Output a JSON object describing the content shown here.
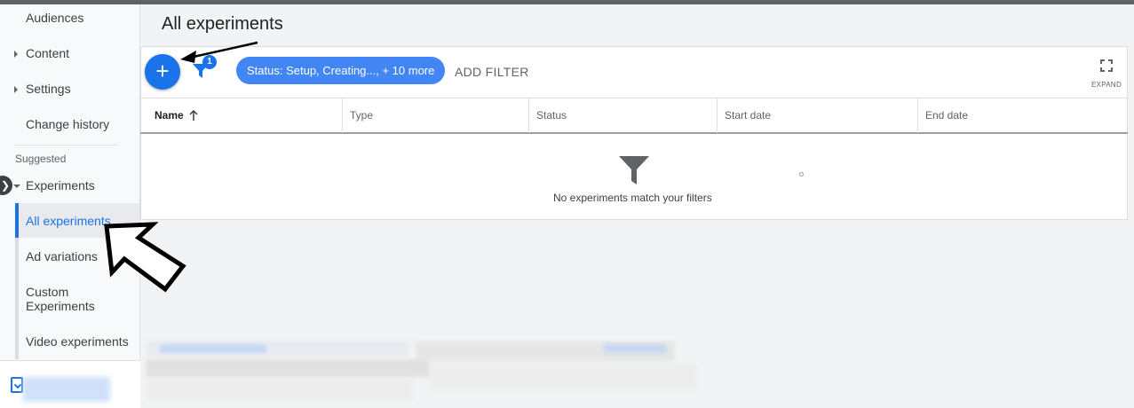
{
  "page": {
    "title": "All experiments"
  },
  "sidebar": {
    "items": [
      {
        "label": "Audiences",
        "caret": false
      },
      {
        "label": "Content",
        "caret": true
      },
      {
        "label": "Settings",
        "caret": true
      },
      {
        "label": "Change history",
        "caret": false
      }
    ],
    "section_label": "Suggested",
    "experiments_label": "Experiments",
    "sub_items": [
      {
        "label": "All experiments",
        "active": true
      },
      {
        "label": "Ad variations",
        "active": false
      },
      {
        "label": "Custom Experiments",
        "active": false
      },
      {
        "label": "Video experiments",
        "active": false
      }
    ],
    "active_color": "#1a73e8"
  },
  "toolbar": {
    "add_button_icon": "plus-icon",
    "add_button_glyph": "+",
    "filter_icon": "filter-icon",
    "filter_count": "1",
    "filter_chip_label": "Status: Setup, Creating..., + 10 more",
    "add_filter_label": "ADD FILTER",
    "expand_label": "EXPAND"
  },
  "table": {
    "columns": [
      {
        "label": "Name",
        "sorted": "ascending"
      },
      {
        "label": "Type"
      },
      {
        "label": "Status"
      },
      {
        "label": "Start date"
      },
      {
        "label": "End date"
      }
    ],
    "empty_message": "No experiments match your filters"
  },
  "colors": {
    "primary": "#1a73e8",
    "chip": "#4285f4",
    "background": "#f1f3f4"
  }
}
